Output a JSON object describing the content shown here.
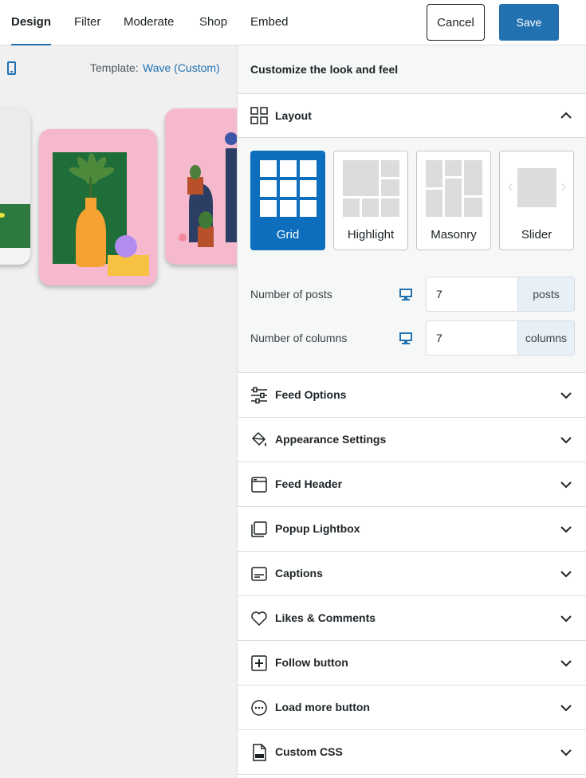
{
  "tabs": [
    {
      "label": "Design",
      "active": true
    },
    {
      "label": "Filter",
      "active": false
    },
    {
      "label": "Moderate",
      "active": false
    },
    {
      "label": "Shop",
      "active": false
    },
    {
      "label": "Embed",
      "active": false
    }
  ],
  "actions": {
    "cancel_label": "Cancel",
    "save_label": "Save"
  },
  "preview": {
    "template_label": "Template:",
    "template_value": "Wave (Custom)"
  },
  "sidebar": {
    "title": "Customize the look and feel",
    "layout": {
      "label": "Layout",
      "expanded": true,
      "options": [
        {
          "label": "Grid",
          "selected": true
        },
        {
          "label": "Highlight",
          "selected": false
        },
        {
          "label": "Masonry",
          "selected": false
        },
        {
          "label": "Slider",
          "selected": false
        }
      ],
      "posts": {
        "label": "Number of posts",
        "value": "7",
        "unit": "posts"
      },
      "columns": {
        "label": "Number of columns",
        "value": "7",
        "unit": "columns"
      }
    },
    "sections": [
      {
        "label": "Feed Options",
        "icon": "sliders-icon"
      },
      {
        "label": "Appearance Settings",
        "icon": "paint-bucket-icon"
      },
      {
        "label": "Feed Header",
        "icon": "browser-window-icon"
      },
      {
        "label": "Popup Lightbox",
        "icon": "stacked-pages-icon"
      },
      {
        "label": "Captions",
        "icon": "caption-icon"
      },
      {
        "label": "Likes & Comments",
        "icon": "heart-icon"
      },
      {
        "label": "Follow button",
        "icon": "plus-box-icon"
      },
      {
        "label": "Load more button",
        "icon": "more-dots-icon"
      },
      {
        "label": "Custom CSS",
        "icon": "css-file-icon"
      }
    ]
  },
  "colors": {
    "accent": "#2271b1",
    "selected_layout": "#0c6ebd",
    "preview_bg": "#f0f0f1",
    "card_pink": "#f5b8cc",
    "card_green": "#1f7a3f"
  }
}
